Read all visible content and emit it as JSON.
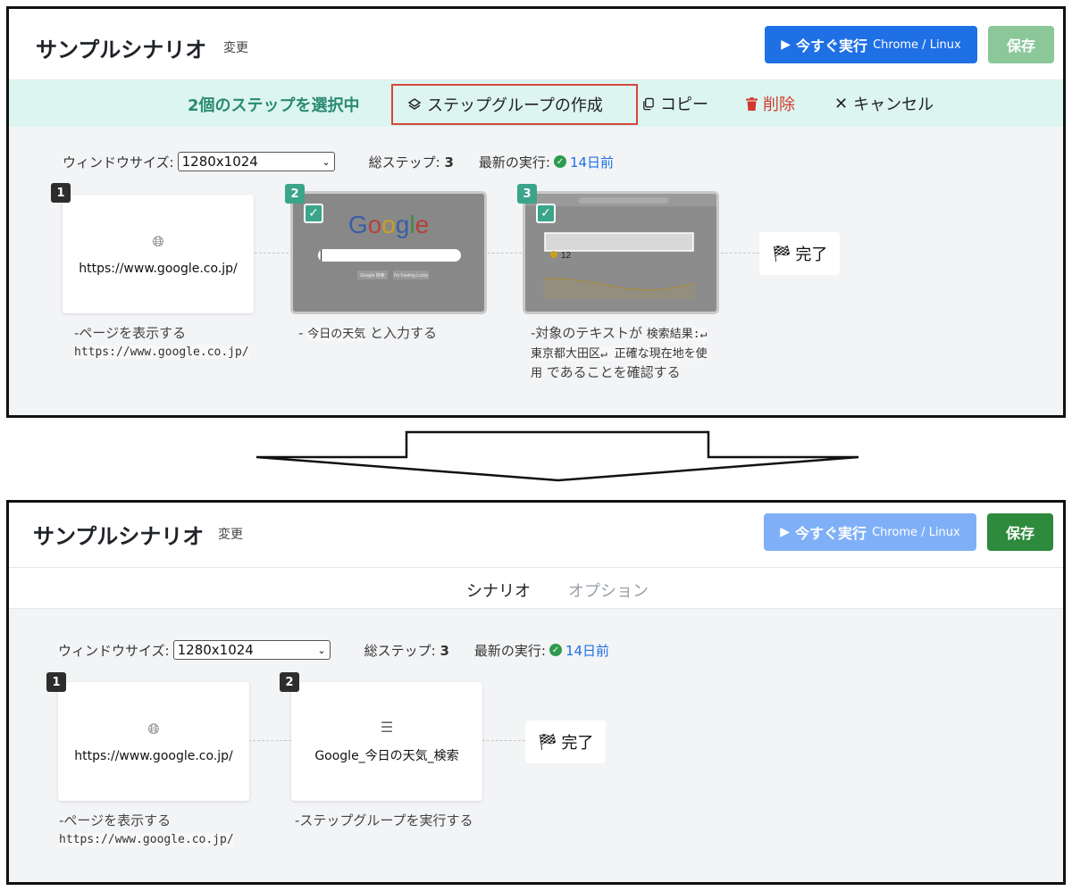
{
  "before": {
    "title": "サンプルシナリオ",
    "rename": "変更",
    "run_button": {
      "label": "今すぐ実行",
      "env": "Chrome / Linux"
    },
    "save_button": "保存",
    "selection_bar": {
      "count_text": "2個のステップを選択中",
      "create_group": "ステップグループの作成",
      "copy": "コピー",
      "delete": "削除",
      "cancel": "キャンセル"
    },
    "meta": {
      "window_size_label": "ウィンドウサイズ:",
      "window_size_value": "1280x1024",
      "total_steps_label": "総ステップ:",
      "total_steps_value": "3",
      "last_run_label": "最新の実行:",
      "last_run_value": "14日前"
    },
    "steps": [
      {
        "number": "1",
        "url": "https://www.google.co.jp/",
        "caption_prefix": "ページを表示する",
        "caption_code": "https://www.google.co.jp/"
      },
      {
        "number": "2",
        "caption_code": "今日の天気",
        "caption_suffix": "と入力する",
        "thumb_logo": "Google",
        "thumb_btn1": "Google 検索",
        "thumb_btn2": "I'm Feeling Lucky"
      },
      {
        "number": "3",
        "caption_prefix": "対象のテキストが",
        "caption_code": "検索結果:↵東京都大田区↵ 正確な現在地を使用",
        "caption_suffix": "であることを確認する",
        "thumb_temp": "12"
      }
    ],
    "done": "完了"
  },
  "after": {
    "title": "サンプルシナリオ",
    "rename": "変更",
    "run_button": {
      "label": "今すぐ実行",
      "env": "Chrome / Linux"
    },
    "save_button": "保存",
    "tabs": {
      "scenario": "シナリオ",
      "options": "オプション"
    },
    "meta": {
      "window_size_label": "ウィンドウサイズ:",
      "window_size_value": "1280x1024",
      "total_steps_label": "総ステップ:",
      "total_steps_value": "3",
      "last_run_label": "最新の実行:",
      "last_run_value": "14日前"
    },
    "steps": [
      {
        "number": "1",
        "url": "https://www.google.co.jp/",
        "caption_prefix": "ページを表示する",
        "caption_code": "https://www.google.co.jp/"
      },
      {
        "number": "2",
        "group_name": "Google_今日の天気_検索",
        "caption": "ステップグループを実行する"
      }
    ],
    "done": "完了"
  },
  "colors": {
    "primary": "#1f6fe5",
    "primary_disabled": "#7fb0f7",
    "success": "#2e8a3d",
    "success_disabled": "#8cc79a",
    "selection_bg": "#dcf5f0",
    "selection_text": "#2a8a70",
    "danger": "#d33a2f",
    "highlight_border": "#d9453a"
  },
  "icons": [
    "play-icon",
    "layers-icon",
    "copy-icon",
    "trash-icon",
    "close-icon",
    "globe-icon",
    "checkbox-checked-icon",
    "check-circle-icon",
    "chevron-down-icon",
    "checkered-flag-icon",
    "list-check-icon",
    "arrow-down-icon"
  ]
}
